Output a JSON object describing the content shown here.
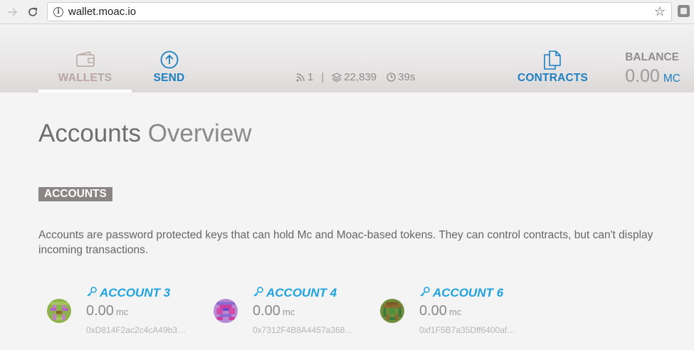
{
  "browser": {
    "url": "wallet.moac.io"
  },
  "header": {
    "nav": {
      "wallets_label": "WALLETS",
      "send_label": "SEND",
      "contracts_label": "CONTRACTS"
    },
    "stats": {
      "peers": "1",
      "block": "22,839",
      "time": "39s"
    },
    "balance": {
      "title": "BALANCE",
      "amount": "0.00",
      "unit": "MC"
    }
  },
  "main": {
    "title_bold": "Accounts",
    "title_light": "Overview",
    "section_label": "ACCOUNTS",
    "description": "Accounts are password protected keys that can hold Mc and Moac-based tokens. They can control contracts, but can't display incoming transactions.",
    "accounts": [
      {
        "name": "ACCOUNT 3",
        "balance": "0.00",
        "unit": "mc",
        "address": "0xD814F2ac2c4cA49b3…"
      },
      {
        "name": "ACCOUNT 4",
        "balance": "0.00",
        "unit": "mc",
        "address": "0x7312F4B8A4457a368…"
      },
      {
        "name": "ACCOUNT 6",
        "balance": "0.00",
        "unit": "mc",
        "address": "0xf1F5B7a35Dff6400af…"
      }
    ]
  },
  "colors": {
    "accent": "#1e7fc2",
    "account_link": "#1fa2e0",
    "badge_bg": "#8b8585"
  }
}
